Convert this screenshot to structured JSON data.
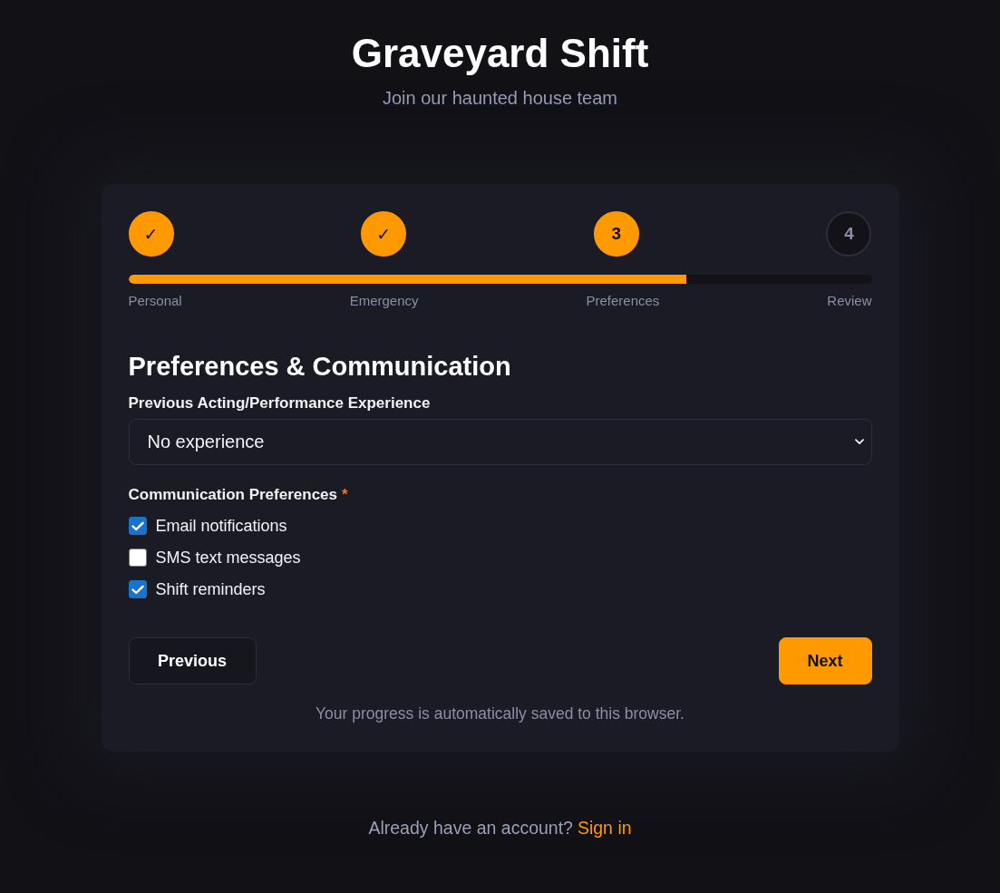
{
  "header": {
    "title": "Graveyard Shift",
    "subtitle": "Join our haunted house team"
  },
  "stepper": {
    "steps": [
      {
        "marker": "✓",
        "label": "Personal",
        "reached": true
      },
      {
        "marker": "✓",
        "label": "Emergency",
        "reached": true
      },
      {
        "marker": "3",
        "label": "Preferences",
        "reached": true
      },
      {
        "marker": "4",
        "label": "Review",
        "reached": false
      }
    ],
    "progress": {
      "level": 0.75
    }
  },
  "form": {
    "heading": "Preferences & Communication",
    "fields": [
      {
        "kind": "select",
        "label": "Previous Acting/Performance Experience",
        "value": "No experience"
      },
      {
        "kind": "checkbox_group",
        "label": "Communication Preferences",
        "required_mark": "*",
        "options": [
          {
            "label": "Email notifications",
            "checked": true
          },
          {
            "label": "SMS text messages",
            "checked": false
          },
          {
            "label": "Shift reminders",
            "checked": true
          }
        ]
      }
    ]
  },
  "actions": [
    {
      "label": "Previous",
      "kind": "secondary"
    },
    {
      "label": "Next",
      "kind": "primary"
    }
  ],
  "save_note": "Your progress is automatically saved to this browser.",
  "footer": {
    "text": "Already have an account?",
    "link": "Sign in"
  }
}
